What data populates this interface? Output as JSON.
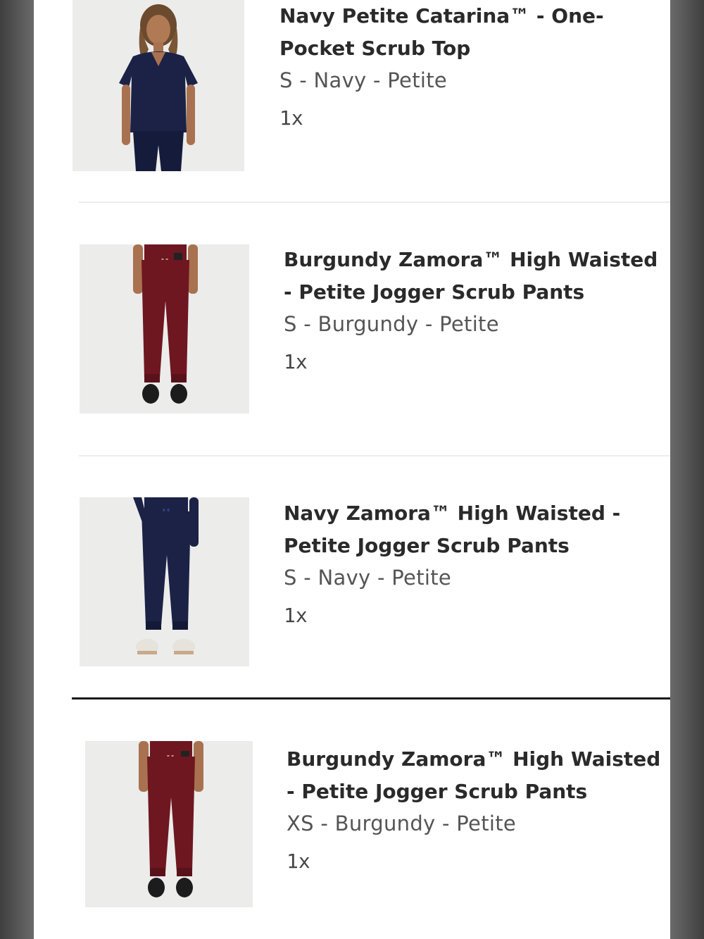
{
  "cart": {
    "items": [
      {
        "title_line1": "Navy Petite Catarina™ - One-",
        "title_line2": "Pocket Scrub Top",
        "variant": "S - Navy - Petite",
        "quantity": "1x",
        "color": "#1b2246"
      },
      {
        "title_line1": "Burgundy Zamora™ High Waisted",
        "title_line2": "- Petite Jogger Scrub Pants",
        "variant": "S - Burgundy - Petite",
        "quantity": "1x",
        "color": "#6e1720"
      },
      {
        "title_line1": "Navy Zamora™ High Waisted -",
        "title_line2": "Petite Jogger Scrub Pants",
        "variant": "S - Navy - Petite",
        "quantity": "1x",
        "color": "#1b2246"
      },
      {
        "title_line1": "Burgundy Zamora™ High Waisted",
        "title_line2": "- Petite Jogger Scrub Pants",
        "variant": "XS - Burgundy - Petite",
        "quantity": "1x",
        "color": "#6e1720"
      }
    ]
  },
  "colors": {
    "navy": "#1b2246",
    "burgundy": "#6e1720",
    "thumb_bg": "#ececeb",
    "bezel": "#5c5c5c"
  }
}
